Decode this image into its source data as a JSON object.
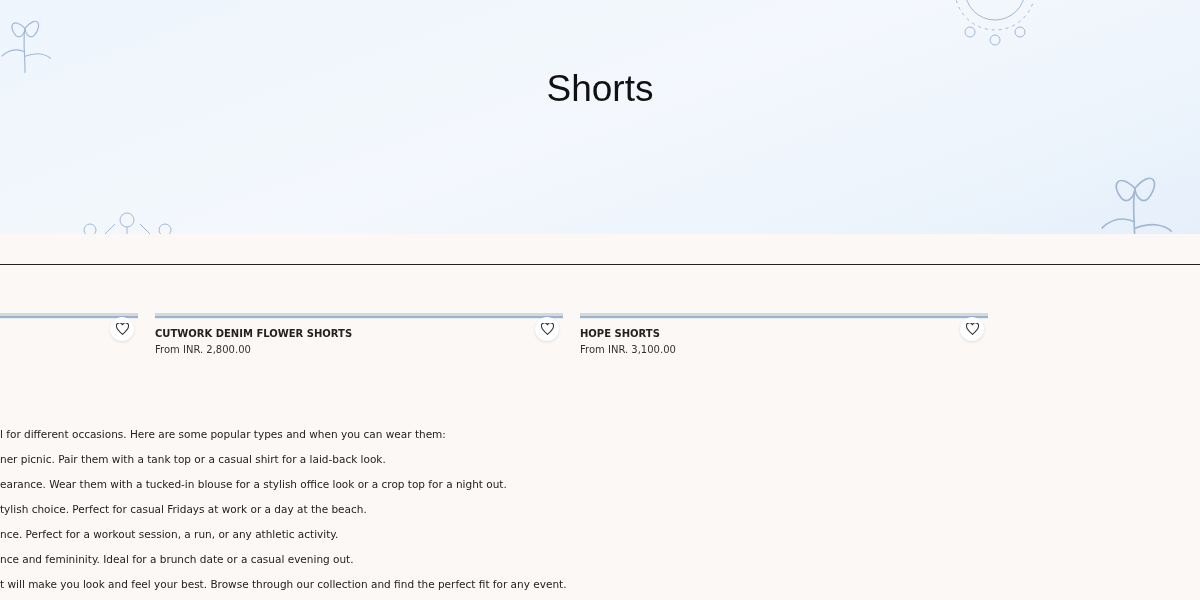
{
  "banner": {
    "title": "Shorts"
  },
  "products": [
    {
      "wishlisted": false
    },
    {
      "name": "CUTWORK DENIM FLOWER SHORTS",
      "price": "From INR. 2,800.00",
      "wishlisted": false
    },
    {
      "name": "HOPE SHORTS",
      "price": "From INR. 3,100.00",
      "wishlisted": false
    }
  ],
  "description": [
    "l for different occasions. Here are some popular types and when you can wear them:",
    "ner picnic. Pair them with a tank top or a casual shirt for a laid-back look.",
    "earance. Wear them with a tucked-in blouse for a stylish office look or a crop top for a night out.",
    "tylish choice. Perfect for casual Fridays at work or a day at the beach.",
    "nce. Perfect for a workout session, a run, or any athletic activity.",
    "nce and femininity. Ideal for a brunch date or a casual evening out.",
    "t will make you look and feel your best. Browse through our collection and find the perfect fit for any event."
  ]
}
